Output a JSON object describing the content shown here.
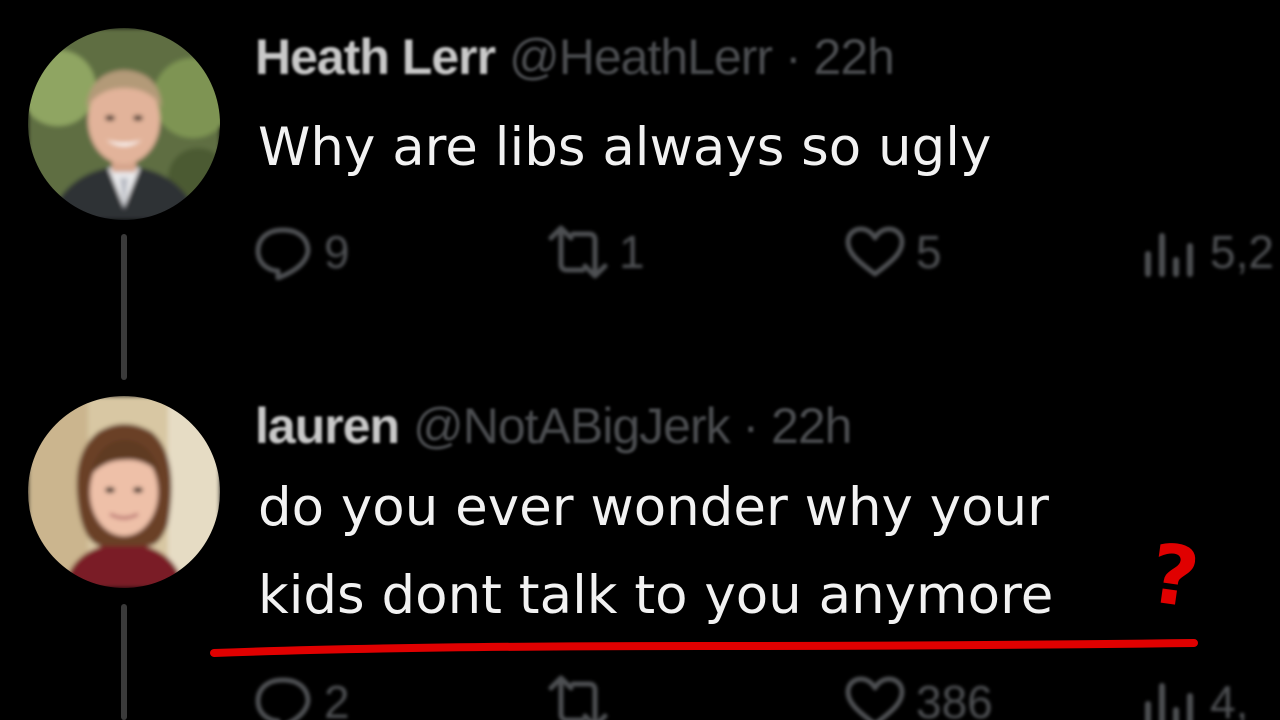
{
  "tweets": [
    {
      "display_name": "Heath Lerr",
      "handle": "@HeathLerr",
      "separator": " · ",
      "time": "22h",
      "text_lines": [
        "Why are libs always so ugly"
      ],
      "actions": {
        "replies": "9",
        "retweets": "1",
        "likes": "5",
        "views": "5,2"
      }
    },
    {
      "display_name": "lauren",
      "handle": "@NotABigJerk",
      "separator": " · ",
      "time": "22h",
      "text_lines": [
        "do you ever wonder why your",
        "kids dont talk to you anymore"
      ],
      "actions": {
        "replies": "2",
        "retweets": "",
        "likes": "386",
        "views": "4,"
      }
    }
  ],
  "annotation": {
    "mark": "?",
    "color": "#e00000"
  },
  "icons": {
    "reply": "speech-bubble-icon",
    "retweet": "retweet-arrows-icon",
    "like": "heart-icon",
    "views": "bar-chart-icon"
  }
}
